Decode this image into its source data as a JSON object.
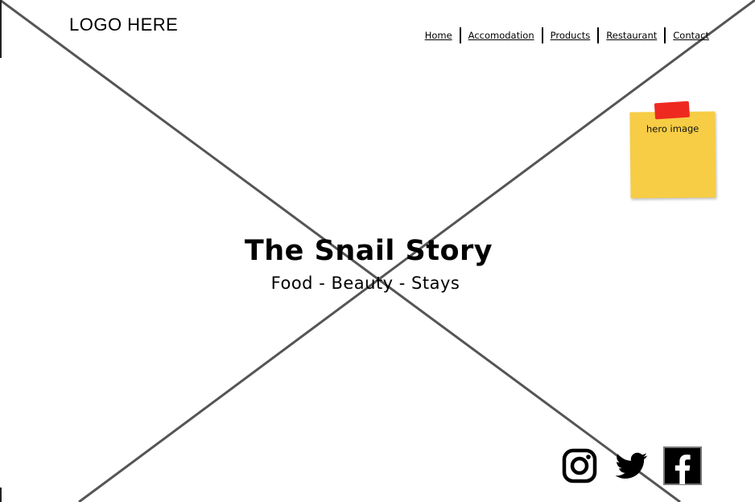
{
  "header": {
    "logo_text": "LOGO HERE",
    "nav": [
      "Home",
      "Accomodation",
      "Products",
      "Restaurant",
      "Contact"
    ]
  },
  "hero": {
    "sticky_note": "hero image",
    "title": "The Snail Story",
    "subtitle": "Food - Beauty - Stays"
  },
  "social": {
    "icons": [
      "instagram-icon",
      "twitter-icon",
      "facebook-icon"
    ]
  },
  "colors": {
    "placeholder_line": "#555555",
    "sticky_note": "#f6cd44",
    "tape": "#ee2a20",
    "text": "#000000"
  }
}
